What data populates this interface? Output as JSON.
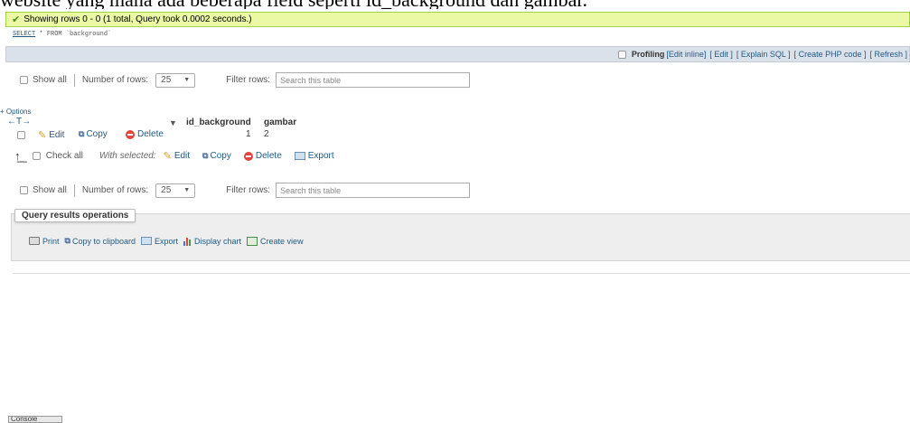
{
  "overlay_text": "website yang mana ada beberapa field seperti id_background dan gambar.",
  "message": {
    "text": "Showing rows 0 - 0 (1 total, Query took 0.0002 seconds.)",
    "colors": {
      "bg": "#ebf8a4",
      "border": "#a2d246"
    }
  },
  "query": {
    "keyword": "SELECT",
    "rest": " * FROM `background`"
  },
  "profiling": {
    "label": "Profiling",
    "links": [
      "[Edit inline]",
      "[ Edit ]",
      "[ Explain SQL ]",
      "[ Create PHP code ]",
      "[ Refresh ]"
    ]
  },
  "nav_top": {
    "show_all": "Show all",
    "rows_label": "Number of rows:",
    "rows_value": "25",
    "filter_label": "Filter rows:",
    "filter_placeholder": "Search this table"
  },
  "options_label": "+ Options",
  "table": {
    "sort_arrows": "←T→",
    "columns": [
      "id_background",
      "gambar"
    ],
    "rows": [
      {
        "edit": "Edit",
        "copy": "Copy",
        "delete": "Delete",
        "id_background": "1",
        "gambar": "2"
      }
    ]
  },
  "bulk": {
    "check_all": "Check all",
    "with_selected": "With selected:",
    "edit": "Edit",
    "copy": "Copy",
    "delete": "Delete",
    "export": "Export"
  },
  "nav_bottom": {
    "show_all": "Show all",
    "rows_label": "Number of rows:",
    "rows_value": "25",
    "filter_label": "Filter rows:",
    "filter_placeholder": "Search this table"
  },
  "operations": {
    "legend": "Query results operations",
    "items": [
      "Print",
      "Copy to clipboard",
      "Export",
      "Display chart",
      "Create view"
    ]
  },
  "console_label": "Console"
}
